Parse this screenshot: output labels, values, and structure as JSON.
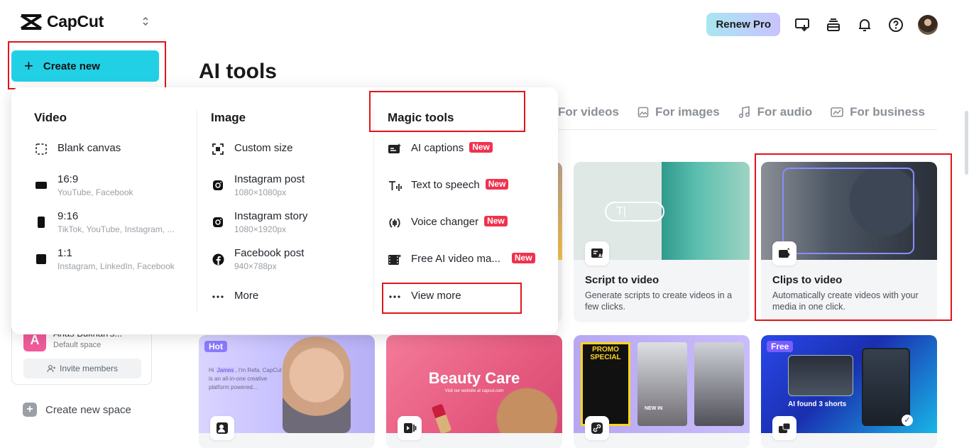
{
  "app": {
    "name": "CapCut",
    "brand_color": "#22d0e6"
  },
  "topbar": {
    "renew_label": "Renew Pro",
    "icons": [
      "monitor-download-icon",
      "stack-icon",
      "bell-icon",
      "help-icon",
      "user-avatar"
    ]
  },
  "sidebar": {
    "create_label": "Create new",
    "space_name": "Anas Bukhari's...",
    "space_initial": "A",
    "space_sub": "Default space",
    "invite_label": "Invite members",
    "new_space_label": "Create new space"
  },
  "main": {
    "title": "AI tools",
    "tabs": [
      {
        "label": "For videos",
        "icon": "video-icon"
      },
      {
        "label": "For images",
        "icon": "image-icon"
      },
      {
        "label": "For audio",
        "icon": "music-icon"
      },
      {
        "label": "For business",
        "icon": "business-icon"
      }
    ],
    "cards": [
      {
        "title": "Script to video",
        "desc": "Generate scripts to create videos in a few clicks.",
        "icon": "script-ai-icon"
      },
      {
        "title": "Clips to video",
        "desc": "Automatically create videos with your media in one click.",
        "icon": "clips-icon"
      }
    ],
    "bottom_cards": [
      {
        "badge": "Hot",
        "caption_prefix": "Hi ",
        "caption_name": "James",
        "caption_rest": ", I'm Refa. CapCut is an all-in-one creative platform powered..."
      },
      {
        "headline": "Beauty Care",
        "small_text": "Visit our website at capcut.com"
      },
      {
        "promo_text": "PROMO SPECIAL",
        "tag": "NEW IN"
      },
      {
        "badge": "Free",
        "caption": "AI found 3 shorts"
      }
    ]
  },
  "dropdown": {
    "video": {
      "heading": "Video",
      "items": [
        {
          "label": "Blank canvas",
          "sub": ""
        },
        {
          "label": "16:9",
          "sub": "YouTube, Facebook"
        },
        {
          "label": "9:16",
          "sub": "TikTok, YouTube, Instagram, ..."
        },
        {
          "label": "1:1",
          "sub": "Instagram, LinkedIn, Facebook"
        }
      ]
    },
    "image": {
      "heading": "Image",
      "items": [
        {
          "label": "Custom size",
          "sub": ""
        },
        {
          "label": "Instagram post",
          "sub": "1080×1080px"
        },
        {
          "label": "Instagram story",
          "sub": "1080×1920px"
        },
        {
          "label": "Facebook post",
          "sub": "940×788px"
        },
        {
          "label": "More",
          "sub": ""
        }
      ]
    },
    "magic": {
      "heading": "Magic tools",
      "new_label": "New",
      "items": [
        {
          "label": "AI captions"
        },
        {
          "label": "Text to speech"
        },
        {
          "label": "Voice changer"
        },
        {
          "label": "Free AI video ma..."
        },
        {
          "label": "View more"
        }
      ]
    }
  }
}
